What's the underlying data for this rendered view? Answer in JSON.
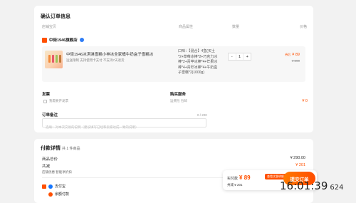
{
  "confirm": {
    "title": "确认订单信息",
    "col_product": "店铺宝贝",
    "col_attr": "商品属性",
    "col_qty": "数量",
    "col_price": "价格",
    "shop_name": "中街1946旗舰店",
    "item": {
      "title": "中街1946冰淇淋雪糕小神冰全家桶牛奶盒子雪糕冰",
      "subtitle": "运送限制  支持使用卡支付  不支持7天退货",
      "attr": "口味：【混合】4盒(买土*2+草莓冰棒*2+巧克力冰棒*2+青苹冰棒*4+芒果冰棒*4+青柠冰棒*4+牛奶盒子雪糕*2)1000g)",
      "qty_minus": "-",
      "qty_value": "1",
      "qty_plus": "+",
      "price_label": "券后",
      "price_now": "¥ 89",
      "price_old": "¥ 290"
    },
    "invoice_title": "发票",
    "invoice_option": "我需要开发票",
    "service_title": "购买服务",
    "service_item": "运费险 包邮",
    "service_price": "¥ 0",
    "note_title": "订单备注",
    "note_counter": "0 / 200",
    "note_placeholder": "选填：对本次交易的说明（建议填写已经和卖家达成一致的说明）"
  },
  "payment": {
    "title": "付款详情",
    "count": "共 1 件商品",
    "total_label": "商品总价",
    "total_value": "¥ 290.00",
    "discount_label": "共减",
    "discount_value": "¥ 201",
    "shop_discount_label": "店铺优惠  智能享折扣",
    "method1": "支付宝",
    "method2": "余额付款"
  },
  "footer": {
    "pay_label": "实付款",
    "pay_value": "¥ 89",
    "badge": "查看优惠明细",
    "saved": "共减 ¥ 201",
    "submit": "提交订单"
  },
  "overlay": {
    "time": "16:01:39",
    "ms": "624"
  },
  "colors": {
    "accent": "#ff5000",
    "verify": "#2f7df6"
  }
}
